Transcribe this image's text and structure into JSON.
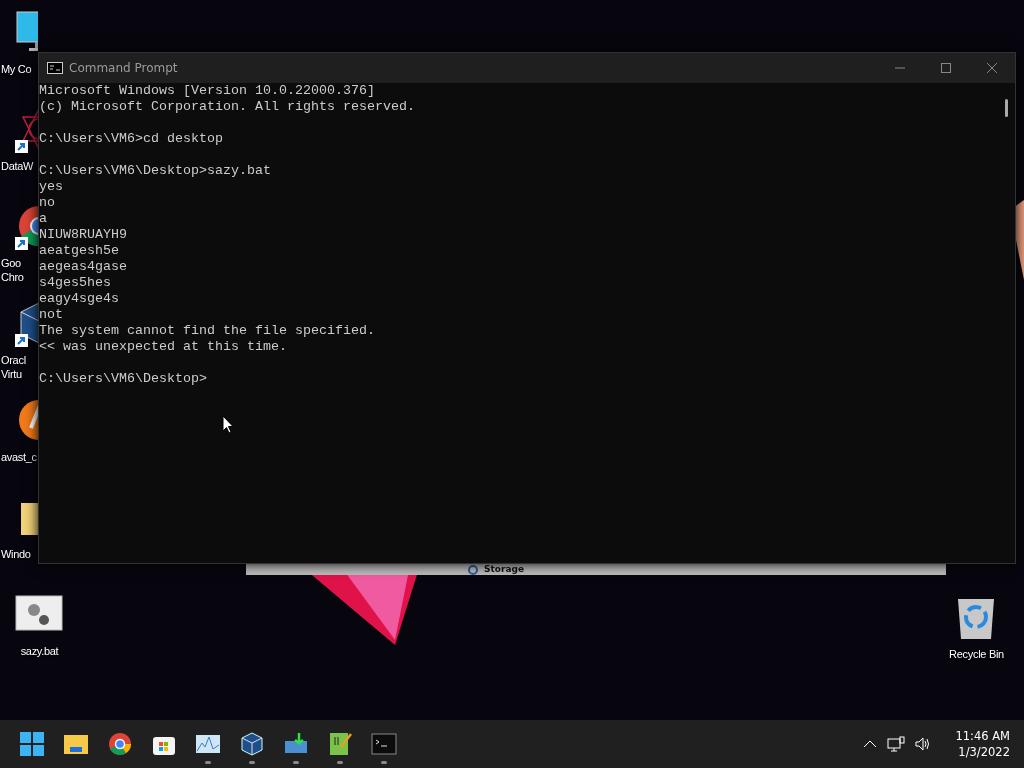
{
  "desktop_icons": [
    {
      "kind": "monitor",
      "lines": [
        "My Co"
      ],
      "shortcut": false
    },
    {
      "kind": "web",
      "lines": [
        "DataW"
      ],
      "shortcut": true
    },
    {
      "kind": "chrome",
      "lines": [
        "Goo",
        "Chro"
      ],
      "shortcut": true
    },
    {
      "kind": "box",
      "lines": [
        "Oracl",
        "Virtu"
      ],
      "shortcut": true
    },
    {
      "kind": "avast",
      "lines": [
        "avast_c"
      ],
      "shortcut": false
    },
    {
      "kind": "folder",
      "lines": [
        "Windo"
      ],
      "shortcut": false
    },
    {
      "kind": "batch",
      "lines": [
        "sazy.bat"
      ],
      "shortcut": false
    }
  ],
  "recycle_bin": {
    "label": "Recycle Bin"
  },
  "background_window": {
    "title": "Storage"
  },
  "window": {
    "title": "Command Prompt",
    "blocks": [
      [
        "Microsoft Windows [Version 10.0.22000.376]",
        "(c) Microsoft Corporation. All rights reserved."
      ],
      [
        "C:\\Users\\VM6>cd desktop"
      ],
      [
        "C:\\Users\\VM6\\Desktop>sazy.bat",
        "yes",
        "no",
        "a",
        "NIUW8RUAYH9",
        "aeatgesh5e",
        "aegeas4gase",
        "s4ges5hes",
        "eagy4sge4s",
        "not",
        "The system cannot find the file specified.",
        "<< was unexpected at this time."
      ],
      [
        "C:\\Users\\VM6\\Desktop>"
      ]
    ]
  },
  "taskbar": {
    "apps": [
      {
        "kind": "start",
        "running": false
      },
      {
        "kind": "folder",
        "running": false
      },
      {
        "kind": "chrome",
        "running": false
      },
      {
        "kind": "store",
        "running": false
      },
      {
        "kind": "chart",
        "running": true
      },
      {
        "kind": "box",
        "running": true
      },
      {
        "kind": "download",
        "running": true
      },
      {
        "kind": "notepad",
        "running": true
      },
      {
        "kind": "terminal",
        "running": true
      }
    ],
    "time": "11:46 AM",
    "date": "1/3/2022"
  }
}
